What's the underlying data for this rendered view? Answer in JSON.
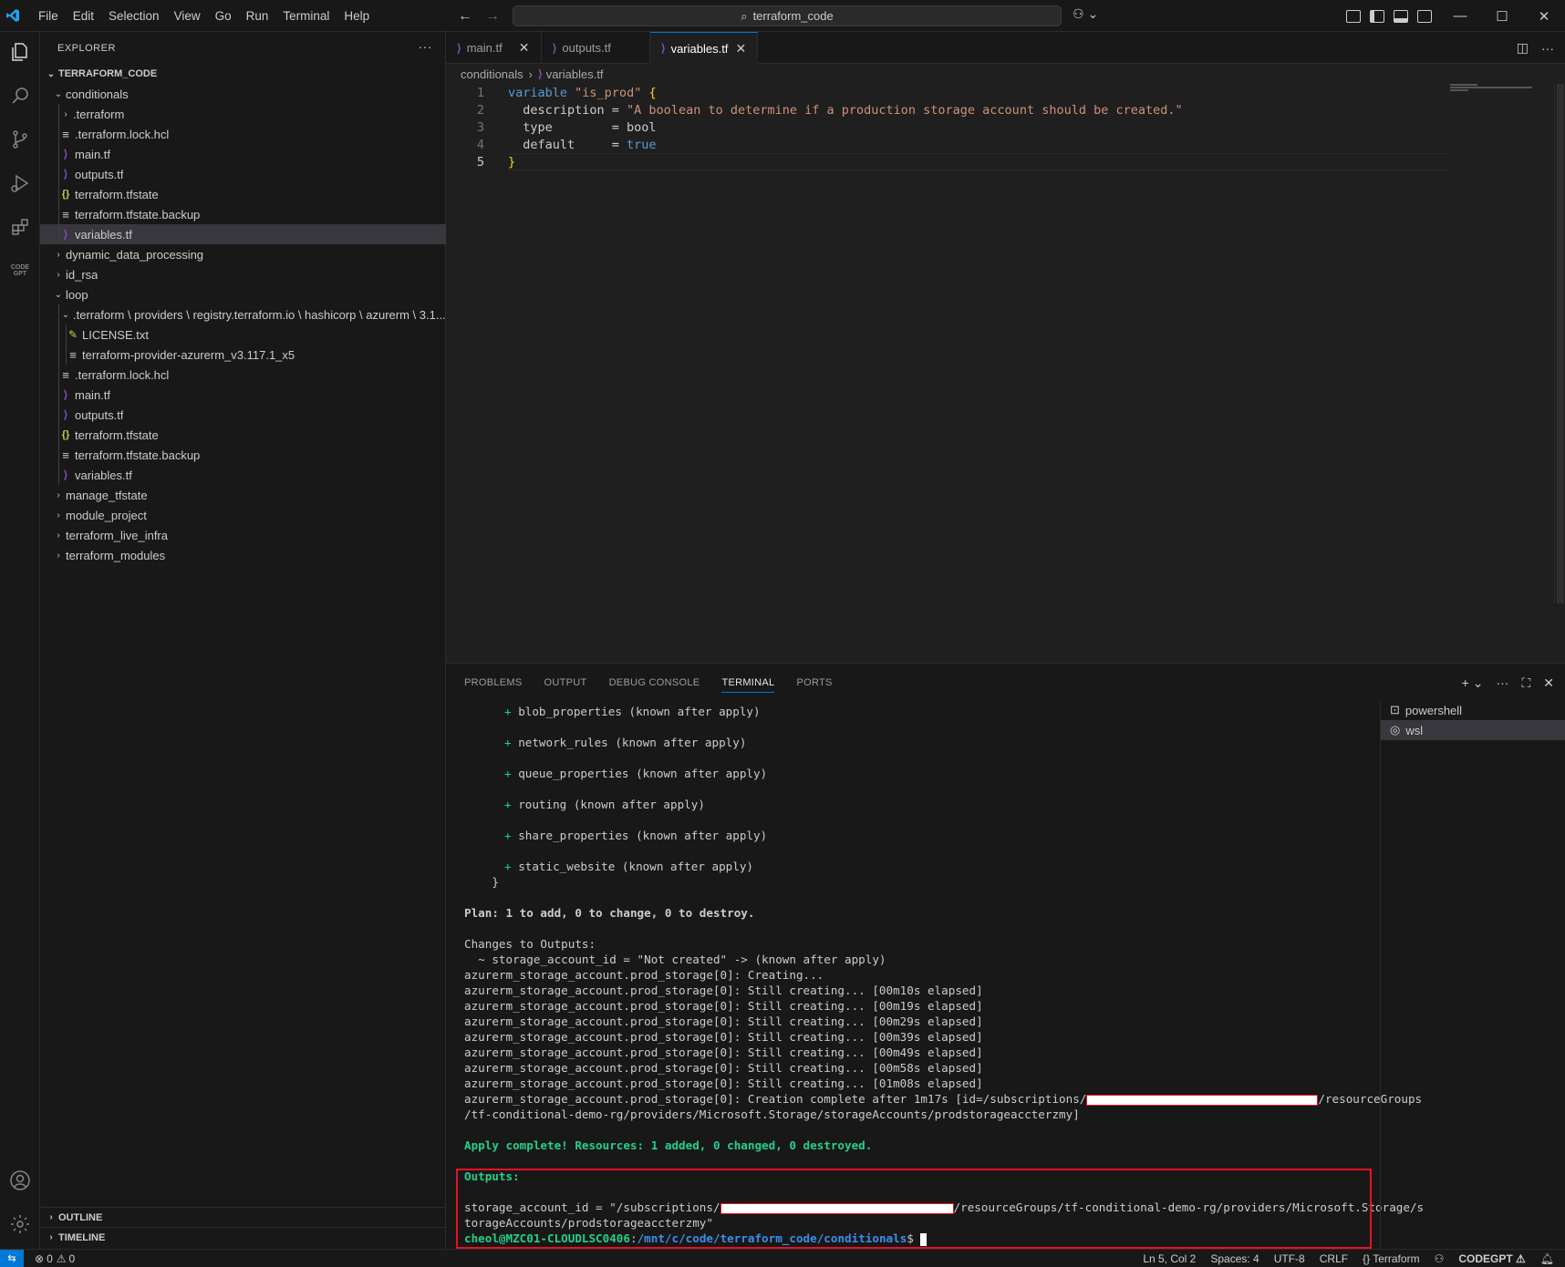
{
  "titlebar": {
    "menu": [
      "File",
      "Edit",
      "Selection",
      "View",
      "Go",
      "Run",
      "Terminal",
      "Help"
    ],
    "search": "terraform_code"
  },
  "explorer": {
    "header": "EXPLORER",
    "root": "TERRAFORM_CODE",
    "items": [
      {
        "label": "conditionals",
        "kind": "folder-open"
      },
      {
        "label": ".terraform",
        "kind": "folder"
      },
      {
        "label": ".terraform.lock.hcl",
        "kind": "lines"
      },
      {
        "label": "main.tf",
        "kind": "tf"
      },
      {
        "label": "outputs.tf",
        "kind": "tf"
      },
      {
        "label": "terraform.tfstate",
        "kind": "json"
      },
      {
        "label": "terraform.tfstate.backup",
        "kind": "lines"
      },
      {
        "label": "variables.tf",
        "kind": "tf"
      },
      {
        "label": "dynamic_data_processing",
        "kind": "folder"
      },
      {
        "label": "id_rsa",
        "kind": "folder"
      },
      {
        "label": "loop",
        "kind": "folder-open"
      },
      {
        "label": ".terraform \\ providers \\ registry.terraform.io \\ hashicorp \\ azurerm \\ 3.1...",
        "kind": "folder-open"
      },
      {
        "label": "LICENSE.txt",
        "kind": "license"
      },
      {
        "label": "terraform-provider-azurerm_v3.117.1_x5",
        "kind": "lines"
      },
      {
        "label": ".terraform.lock.hcl",
        "kind": "lines"
      },
      {
        "label": "main.tf",
        "kind": "tf"
      },
      {
        "label": "outputs.tf",
        "kind": "tf"
      },
      {
        "label": "terraform.tfstate",
        "kind": "json"
      },
      {
        "label": "terraform.tfstate.backup",
        "kind": "lines"
      },
      {
        "label": "variables.tf",
        "kind": "tf"
      },
      {
        "label": "manage_tfstate",
        "kind": "folder"
      },
      {
        "label": "module_project",
        "kind": "folder"
      },
      {
        "label": "terraform_live_infra",
        "kind": "folder"
      },
      {
        "label": "terraform_modules",
        "kind": "folder"
      }
    ],
    "outline": "OUTLINE",
    "timeline": "TIMELINE"
  },
  "tabs": [
    {
      "label": "main.tf"
    },
    {
      "label": "outputs.tf"
    },
    {
      "label": "variables.tf"
    }
  ],
  "breadcrumb": {
    "folder": "conditionals",
    "file": "variables.tf"
  },
  "code": {
    "line_numbers": [
      "1",
      "2",
      "3",
      "4",
      "5"
    ],
    "l1_kw": "variable",
    "l1_str": "\"is_prod\"",
    "l1_brace": "{",
    "l2_key": "  description = ",
    "l2_str": "\"A boolean to determine if a production storage account should be created.\"",
    "l3": "  type        = bool",
    "l4_key": "  default     = ",
    "l4_val": "true",
    "l5_brace": "}"
  },
  "panel": {
    "tabs": [
      "PROBLEMS",
      "OUTPUT",
      "DEBUG CONSOLE",
      "TERMINAL",
      "PORTS"
    ],
    "terminals": [
      "powershell",
      "wsl"
    ]
  },
  "terminal": {
    "blocks": [
      "blob_properties (known after apply)",
      "network_rules (known after apply)",
      "queue_properties (known after apply)",
      "routing (known after apply)",
      "share_properties (known after apply)",
      "static_website (known after apply)"
    ],
    "close_brace": "    }",
    "plan": "Plan: 1 to add, 0 to change, 0 to destroy.",
    "changes_header": "Changes to Outputs:",
    "changes_line": "  ~ storage_account_id = \"Not created\" -> (known after apply)",
    "creating": "azurerm_storage_account.prod_storage[0]: Creating...",
    "still": [
      "azurerm_storage_account.prod_storage[0]: Still creating... [00m10s elapsed]",
      "azurerm_storage_account.prod_storage[0]: Still creating... [00m19s elapsed]",
      "azurerm_storage_account.prod_storage[0]: Still creating... [00m29s elapsed]",
      "azurerm_storage_account.prod_storage[0]: Still creating... [00m39s elapsed]",
      "azurerm_storage_account.prod_storage[0]: Still creating... [00m49s elapsed]",
      "azurerm_storage_account.prod_storage[0]: Still creating... [00m58s elapsed]",
      "azurerm_storage_account.prod_storage[0]: Still creating... [01m08s elapsed]"
    ],
    "complete_a": "azurerm_storage_account.prod_storage[0]: Creation complete after 1m17s [id=/subscriptions/",
    "complete_b": "/resourceGroups",
    "complete_c": "/tf-conditional-demo-rg/providers/Microsoft.Storage/storageAccounts/prodstorageaccterzmy]",
    "apply": "Apply complete! Resources: 1 added, 0 changed, 0 destroyed.",
    "outputs_header": "Outputs:",
    "out_a": "storage_account_id = \"/subscriptions/",
    "out_b": "/resourceGroups/tf-conditional-demo-rg/providers/Microsoft.Storage/s",
    "out_c": "torageAccounts/prodstorageaccterzmy\"",
    "prompt_user": "cheol@MZC01-CLOUDLSC0406",
    "prompt_path": "/mnt/c/code/terraform_code/conditionals",
    "prompt_end": "$ "
  },
  "statusbar": {
    "errors": "0",
    "warnings": "0",
    "position": "Ln 5, Col 2",
    "spaces": "Spaces: 4",
    "encoding": "UTF-8",
    "eol": "CRLF",
    "language": "Terraform",
    "codegpt": "CODEGPT"
  }
}
